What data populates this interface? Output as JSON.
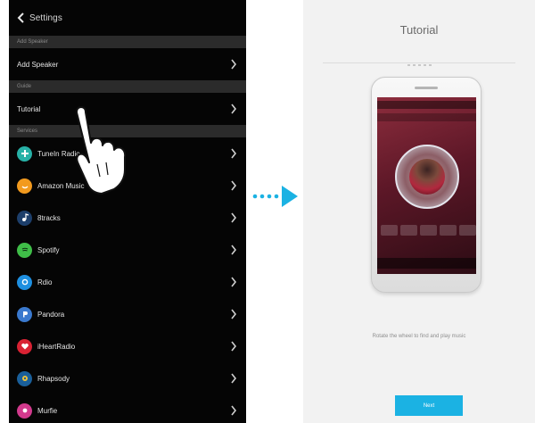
{
  "settings": {
    "title": "Settings",
    "sections": [
      {
        "header": "Add Speaker",
        "items": [
          {
            "label": "Add Speaker"
          }
        ]
      },
      {
        "header": "Guide",
        "items": [
          {
            "label": "Tutorial"
          }
        ]
      },
      {
        "header": "Services",
        "items": [
          {
            "label": "TuneIn Radio",
            "icon": "tunein-icon",
            "color": "#27b1a7"
          },
          {
            "label": "Amazon Music",
            "icon": "amazon-music-icon",
            "color": "#f29a1e"
          },
          {
            "label": "8tracks",
            "icon": "8tracks-icon",
            "color": "#1d3f6b"
          },
          {
            "label": "Spotify",
            "icon": "spotify-icon",
            "color": "#3fbe48"
          },
          {
            "label": "Rdio",
            "icon": "rdio-icon",
            "color": "#1e8fe0"
          },
          {
            "label": "Pandora",
            "icon": "pandora-icon",
            "color": "#3a79ce"
          },
          {
            "label": "iHeartRadio",
            "icon": "iheartradio-icon",
            "color": "#d92233"
          },
          {
            "label": "Rhapsody",
            "icon": "rhapsody-icon",
            "color": "#1a5f9a"
          },
          {
            "label": "Murfie",
            "icon": "murfie-icon",
            "color": "#d23a8d"
          }
        ]
      }
    ]
  },
  "tutorial": {
    "title": "Tutorial",
    "description": "Rotate the wheel to find and play music",
    "next_label": "Next"
  }
}
